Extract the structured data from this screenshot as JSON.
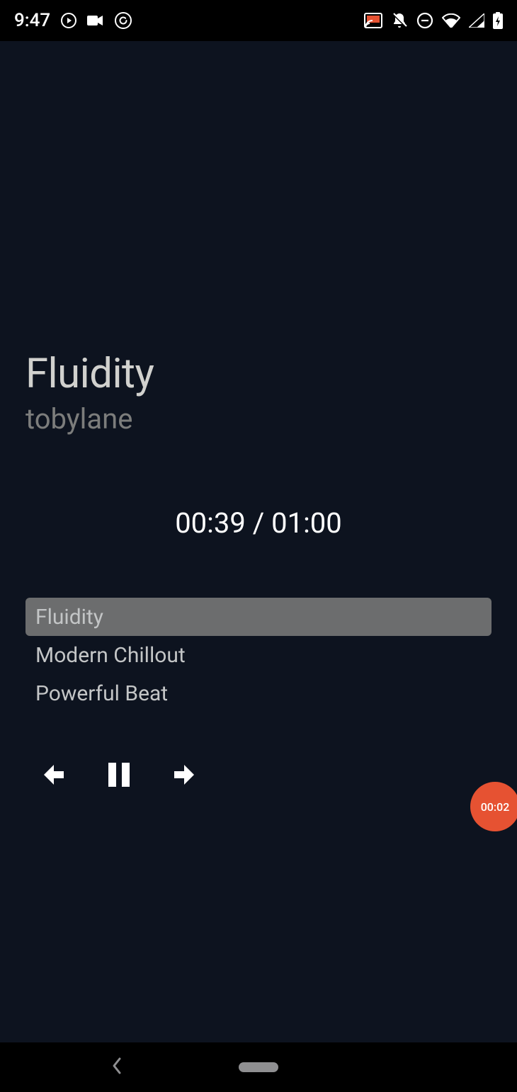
{
  "status": {
    "time": "9:47"
  },
  "player": {
    "title": "Fluidity",
    "artist": "tobylane",
    "elapsed": "00:39",
    "duration": "01:00",
    "time_line": "00:39 / 01:00"
  },
  "playlist": [
    {
      "label": "Fluidity",
      "active": true
    },
    {
      "label": "Modern Chillout",
      "active": false
    },
    {
      "label": "Powerful Beat",
      "active": false
    }
  ],
  "badge": {
    "label": "00:02"
  },
  "colors": {
    "app_bg": "#0d131f",
    "accent": "#e65232",
    "list_active_bg": "#6c6d6e",
    "muted_text": "#7c7d7c"
  }
}
